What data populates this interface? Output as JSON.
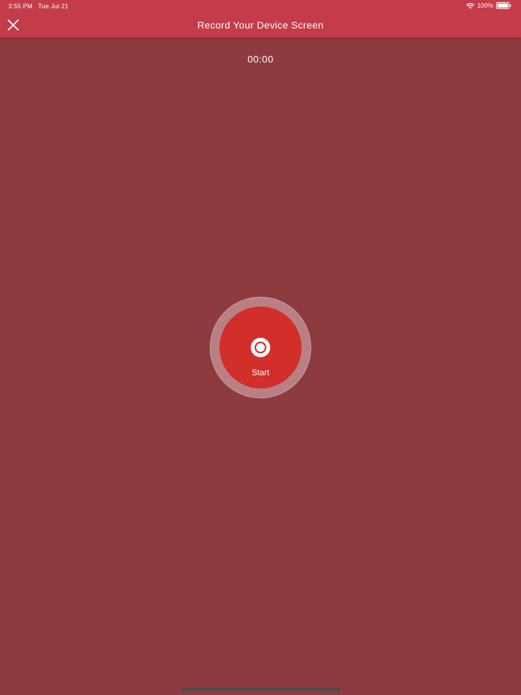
{
  "status_bar": {
    "time": "3:55 PM",
    "date": "Tue Jul 21",
    "battery": "100%"
  },
  "nav": {
    "title": "Record Your Device Screen",
    "close_icon": "close-icon"
  },
  "timer": {
    "value": "00:00"
  },
  "record": {
    "label": "Start",
    "icon": "record-icon"
  },
  "colors": {
    "nav_bar": "#c43c4a",
    "background": "#8e3b40",
    "record_button": "#d22e2a",
    "record_ring": "#b88083"
  }
}
